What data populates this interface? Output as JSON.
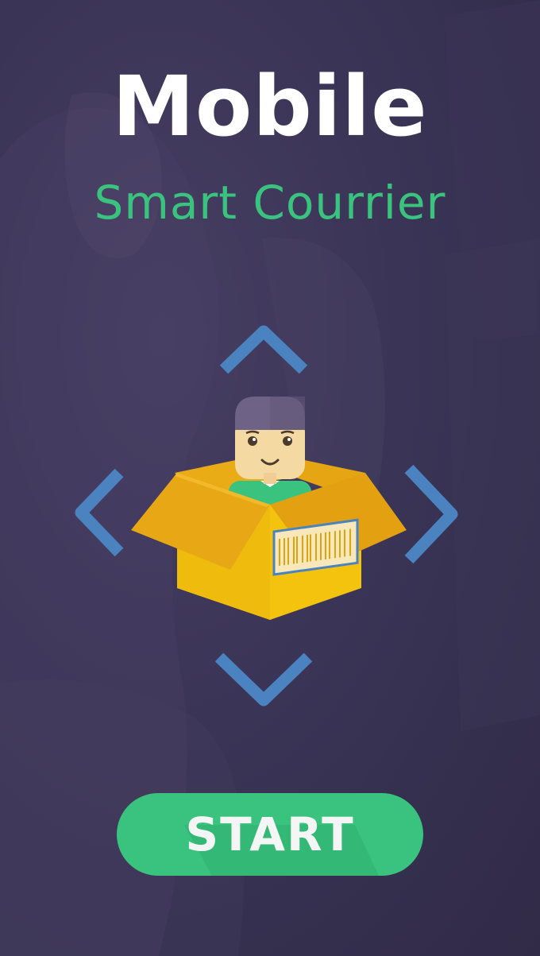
{
  "splash": {
    "title": "Mobile",
    "subtitle": "Smart Courrier"
  },
  "actions": {
    "start_label": "START"
  },
  "colors": {
    "background": "#36304f",
    "accent_green": "#3ac37e",
    "arrow_blue": "#4a83c0",
    "box_yellow": "#f2c00e"
  },
  "icons": {
    "up": "chevron-up-icon",
    "down": "chevron-down-icon",
    "left": "chevron-left-icon",
    "right": "chevron-right-icon",
    "mascot": "courier-in-box-illustration"
  }
}
